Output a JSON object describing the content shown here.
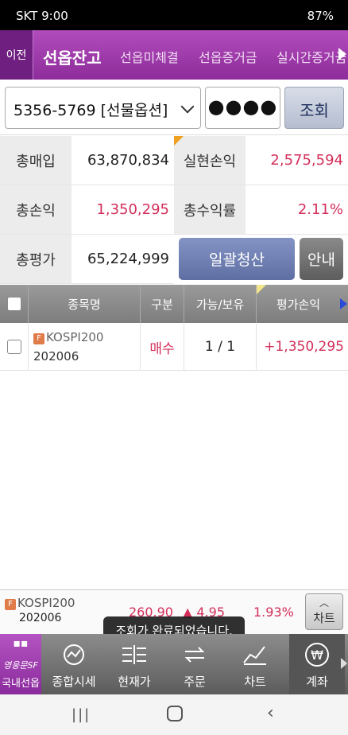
{
  "status_bar": {
    "carrier_time": "SKT 9:00",
    "battery": "87%"
  },
  "tabs": {
    "prev_label": "이전",
    "items": [
      "선옵잔고",
      "선옵미체결",
      "선옵증거금",
      "실시간증거금"
    ]
  },
  "account": {
    "selected": "5356-5769 [선물옵션]",
    "password_mask": "●●●●",
    "query_label": "조회"
  },
  "summary": {
    "total_purchase_label": "총매입",
    "total_purchase": "63,870,834",
    "realized_pl_label": "실현손익",
    "realized_pl": "2,575,594",
    "total_pl_label": "총손익",
    "total_pl": "1,350,295",
    "total_return_label": "총수익률",
    "total_return": "2.11%",
    "total_eval_label": "총평가",
    "total_eval": "65,224,999",
    "liquidate_label": "일괄청산",
    "guide_label": "안내"
  },
  "table": {
    "headers": [
      "종목명",
      "구분",
      "가능/보유",
      "평가손익"
    ],
    "rows": [
      {
        "name": "KOSPI200",
        "code": "202006",
        "side": "매수",
        "qty": "1 / 1",
        "pl": "+1,350,295"
      }
    ]
  },
  "quote": {
    "name": "KOSPI200",
    "code": "202006",
    "price": "260.90",
    "change": "4.95",
    "change_pct": "1.93%",
    "chart_label": "차트"
  },
  "toast": "조회가 완료되었습니다.",
  "bottom_nav": {
    "brand_text": "영웅문SF",
    "items": [
      "국내선옵",
      "종합시세",
      "현재가",
      "주문",
      "차트",
      "계좌"
    ]
  },
  "colors": {
    "accent": "#9c36a8",
    "positive": "#d32f5a",
    "button_blue": "#6f7fb0"
  }
}
